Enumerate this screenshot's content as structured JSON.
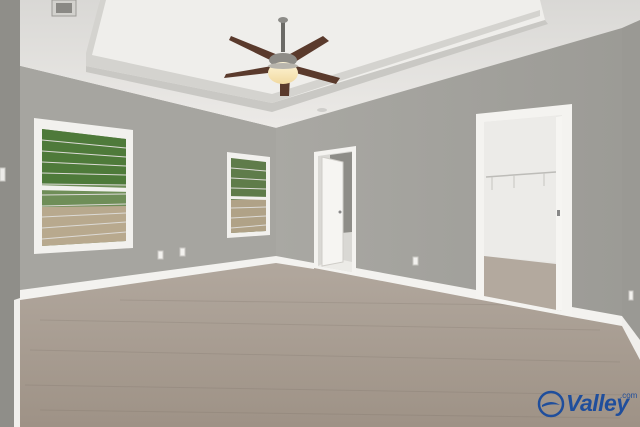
{
  "image": {
    "kind": "photograph",
    "subject": "empty-bedroom-interior"
  },
  "watermark": {
    "text": "Valley",
    "tld": ".com",
    "color": "#1f4e9c"
  },
  "palette": {
    "wall": "#a8a7a2",
    "ceiling": "#e6e5e2",
    "carpet": "#a89c90",
    "trim": "#f2f1ee",
    "fan_blade": "#5a3a2c"
  }
}
